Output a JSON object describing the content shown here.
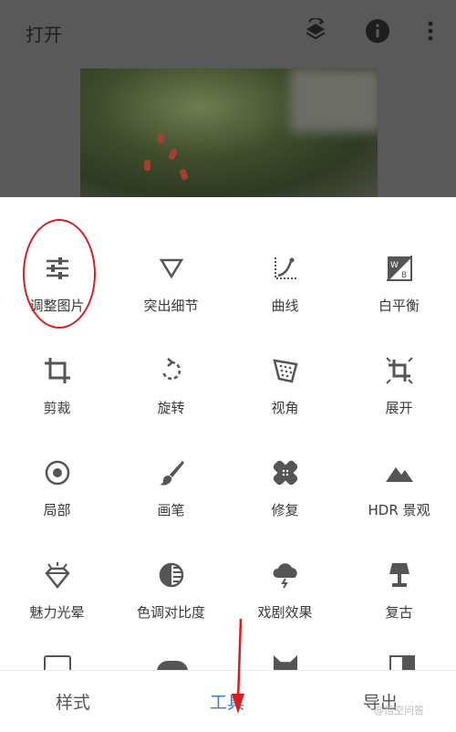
{
  "top": {
    "open_label": "打开"
  },
  "tools": [
    {
      "label": "调整图片",
      "icon": "sliders-icon"
    },
    {
      "label": "突出细节",
      "icon": "triangle-down-icon"
    },
    {
      "label": "曲线",
      "icon": "curves-icon"
    },
    {
      "label": "白平衡",
      "icon": "white-balance-icon"
    },
    {
      "label": "剪裁",
      "icon": "crop-icon"
    },
    {
      "label": "旋转",
      "icon": "rotate-icon"
    },
    {
      "label": "视角",
      "icon": "perspective-icon"
    },
    {
      "label": "展开",
      "icon": "expand-icon"
    },
    {
      "label": "局部",
      "icon": "selective-icon"
    },
    {
      "label": "画笔",
      "icon": "brush-icon"
    },
    {
      "label": "修复",
      "icon": "healing-icon"
    },
    {
      "label": "HDR 景观",
      "icon": "hdr-landscape-icon"
    },
    {
      "label": "魅力光晕",
      "icon": "glamour-glow-icon"
    },
    {
      "label": "色调对比度",
      "icon": "tonal-contrast-icon"
    },
    {
      "label": "戏剧效果",
      "icon": "drama-icon"
    },
    {
      "label": "复古",
      "icon": "vintage-lamp-icon"
    }
  ],
  "tabs": [
    {
      "label": "样式",
      "active": false
    },
    {
      "label": "工具",
      "active": true
    },
    {
      "label": "导出",
      "active": false
    }
  ],
  "watermark": "@悟空问答",
  "colors": {
    "accent": "#2f7fd9",
    "annotation": "#d81e1e"
  }
}
